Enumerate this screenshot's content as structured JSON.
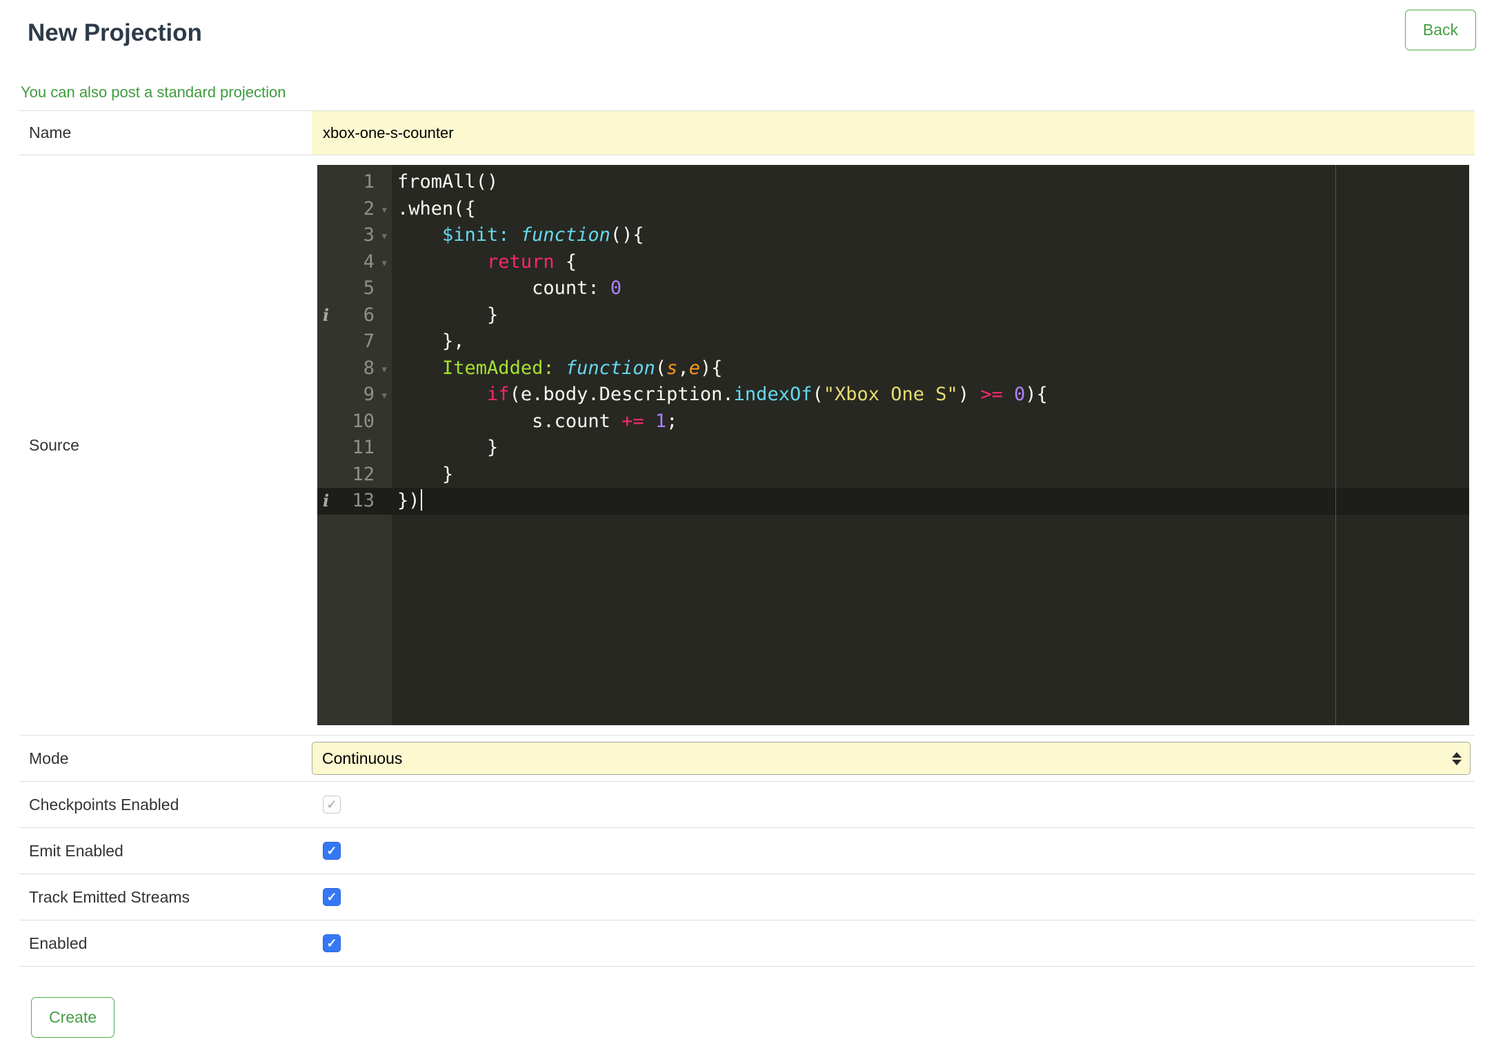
{
  "colors": {
    "accent_green": "#3f9b3f",
    "button_green_border": "#4cae4c",
    "input_yellow": "#fcf8d0",
    "checkbox_blue": "#3578f6",
    "editor_bg": "#272822"
  },
  "header": {
    "title": "New Projection",
    "back_label": "Back",
    "standard_projection_link": "You can also post a standard projection"
  },
  "form": {
    "name": {
      "label": "Name",
      "value": "xbox-one-s-counter"
    },
    "source": {
      "label": "Source"
    },
    "mode": {
      "label": "Mode",
      "value": "Continuous"
    },
    "checkpoints_enabled": {
      "label": "Checkpoints Enabled",
      "checked": true,
      "disabled": true
    },
    "emit_enabled": {
      "label": "Emit Enabled",
      "checked": true,
      "disabled": false
    },
    "track_emitted_streams": {
      "label": "Track Emitted Streams",
      "checked": true,
      "disabled": false
    },
    "enabled": {
      "label": "Enabled",
      "checked": true,
      "disabled": false
    }
  },
  "footer": {
    "create_label": "Create"
  },
  "editor": {
    "cursor_line": 13,
    "active_line": 13,
    "info_lines": [
      6,
      13
    ],
    "fold_lines": [
      2,
      3,
      4,
      8,
      9
    ],
    "lines": [
      {
        "num": 1,
        "tokens": [
          {
            "t": "fromAll()",
            "c": "plain"
          }
        ]
      },
      {
        "num": 2,
        "tokens": [
          {
            "t": ".when({",
            "c": "plain"
          }
        ]
      },
      {
        "num": 3,
        "tokens": [
          {
            "t": "    ",
            "c": "plain"
          },
          {
            "t": "$init:",
            "c": "support"
          },
          {
            "t": " ",
            "c": "plain"
          },
          {
            "t": "function",
            "c": "storage"
          },
          {
            "t": "(){",
            "c": "plain"
          }
        ]
      },
      {
        "num": 4,
        "tokens": [
          {
            "t": "        ",
            "c": "plain"
          },
          {
            "t": "return",
            "c": "keyword"
          },
          {
            "t": " {",
            "c": "plain"
          }
        ]
      },
      {
        "num": 5,
        "tokens": [
          {
            "t": "            count: ",
            "c": "plain"
          },
          {
            "t": "0",
            "c": "number"
          }
        ]
      },
      {
        "num": 6,
        "tokens": [
          {
            "t": "        }",
            "c": "plain"
          }
        ]
      },
      {
        "num": 7,
        "tokens": [
          {
            "t": "    },",
            "c": "plain"
          }
        ]
      },
      {
        "num": 8,
        "tokens": [
          {
            "t": "    ",
            "c": "plain"
          },
          {
            "t": "ItemAdded:",
            "c": "entity"
          },
          {
            "t": " ",
            "c": "plain"
          },
          {
            "t": "function",
            "c": "storage"
          },
          {
            "t": "(",
            "c": "plain"
          },
          {
            "t": "s",
            "c": "param"
          },
          {
            "t": ",",
            "c": "plain"
          },
          {
            "t": "e",
            "c": "param"
          },
          {
            "t": "){",
            "c": "plain"
          }
        ]
      },
      {
        "num": 9,
        "tokens": [
          {
            "t": "        ",
            "c": "plain"
          },
          {
            "t": "if",
            "c": "keyword"
          },
          {
            "t": "(e.body.Description.",
            "c": "plain"
          },
          {
            "t": "indexOf",
            "c": "support"
          },
          {
            "t": "(",
            "c": "plain"
          },
          {
            "t": "\"Xbox One S\"",
            "c": "string"
          },
          {
            "t": ") ",
            "c": "plain"
          },
          {
            "t": ">=",
            "c": "keyword"
          },
          {
            "t": " ",
            "c": "plain"
          },
          {
            "t": "0",
            "c": "number"
          },
          {
            "t": "){",
            "c": "plain"
          }
        ]
      },
      {
        "num": 10,
        "tokens": [
          {
            "t": "            s.count ",
            "c": "plain"
          },
          {
            "t": "+=",
            "c": "keyword"
          },
          {
            "t": " ",
            "c": "plain"
          },
          {
            "t": "1",
            "c": "number"
          },
          {
            "t": ";",
            "c": "plain"
          }
        ]
      },
      {
        "num": 11,
        "tokens": [
          {
            "t": "        }",
            "c": "plain"
          }
        ]
      },
      {
        "num": 12,
        "tokens": [
          {
            "t": "    }",
            "c": "plain"
          }
        ]
      },
      {
        "num": 13,
        "tokens": [
          {
            "t": "})",
            "c": "plain"
          }
        ]
      }
    ]
  }
}
